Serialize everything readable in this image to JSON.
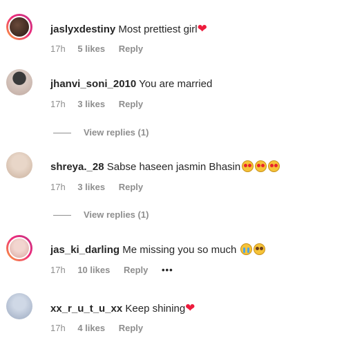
{
  "comments": [
    {
      "username": "jaslyxdestiny",
      "text": "Most prettiest girl",
      "emoji": "red-heart",
      "time": "17h",
      "likes": "5 likes",
      "reply": "Reply"
    },
    {
      "username": "jhanvi_soni_2010",
      "text": "You are married",
      "time": "17h",
      "likes": "3 likes",
      "reply": "Reply",
      "view_replies": "View replies (1)"
    },
    {
      "username": "shreya._28",
      "text": "Sabse haseen jasmin Bhasin",
      "emoji": "heart-eyes x3",
      "time": "17h",
      "likes": "3 likes",
      "reply": "Reply",
      "view_replies": "View replies (1)"
    },
    {
      "username": "jas_ki_darling",
      "text": "Me missing you so much",
      "emoji": "crying, pleading",
      "time": "17h",
      "likes": "10 likes",
      "reply": "Reply",
      "more": "•••"
    },
    {
      "username": "xx_r_u_t_u_xx",
      "text": "Keep shining",
      "emoji": "red-heart",
      "time": "17h",
      "likes": "4 likes",
      "reply": "Reply"
    }
  ],
  "colors": {
    "text": "#262626",
    "meta": "#8e8e8e",
    "heart": "#ed1c3d",
    "story_ring": "#ee2a7b"
  }
}
